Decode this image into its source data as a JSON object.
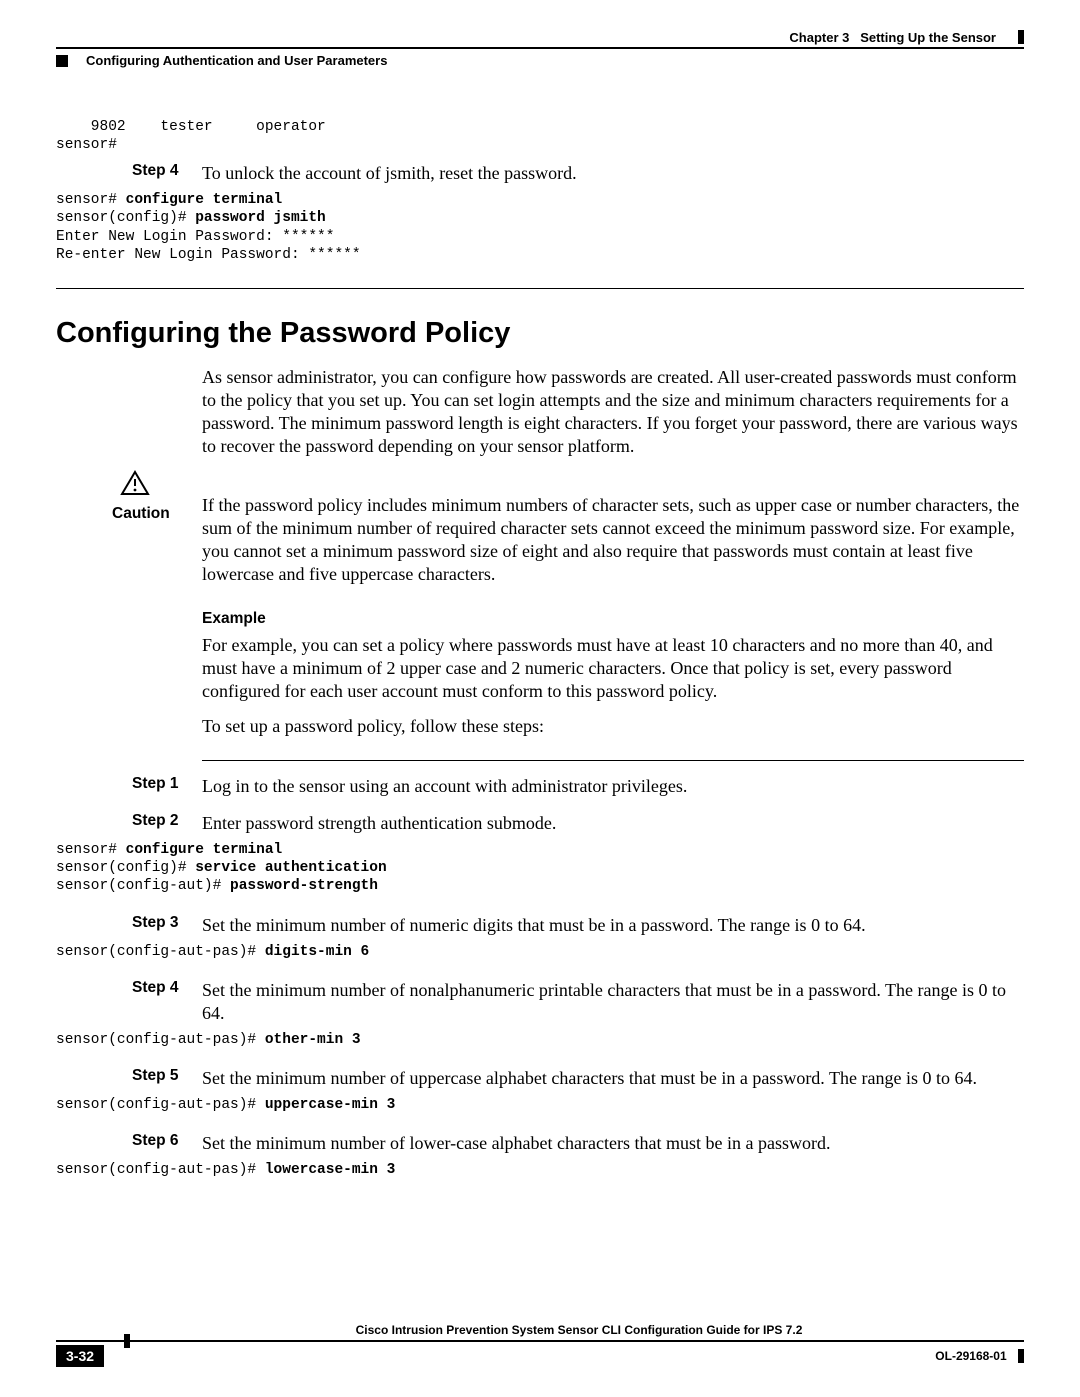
{
  "header": {
    "chapter": "Chapter 3",
    "chapter_title": "Setting Up the Sensor",
    "section": "Configuring Authentication and User Parameters"
  },
  "pretext_code": "    9802    tester     operator\nsensor#",
  "stepA": {
    "label": "Step 4",
    "text": "To unlock the account of jsmith, reset the password.",
    "code_plain1": "sensor# ",
    "code_bold1": "configure terminal",
    "code_plain2": "sensor(config)# ",
    "code_bold2": "password jsmith",
    "code_rest": "Enter New Login Password: ******\nRe-enter New Login Password: ******"
  },
  "section_title": "Configuring the Password Policy",
  "intro_para": "As sensor administrator, you can configure how passwords are created. All user-created passwords must conform to the policy that you set up. You can set login attempts and the size and minimum characters requirements for a password. The minimum password length is eight characters. If you forget your password, there are various ways to recover the password depending on your sensor platform.",
  "caution": {
    "label": "Caution",
    "text": "If the password policy includes minimum numbers of character sets, such as upper case or number characters, the sum of the minimum number of required character sets cannot exceed the minimum password size. For example, you cannot set a minimum password size of eight and also require that passwords must contain at least five lowercase and five uppercase characters."
  },
  "example_hdr": "Example",
  "example_para": "For example, you can set a policy where passwords must have at least 10 characters and no more than 40, and must have a minimum of 2 upper case and 2 numeric characters. Once that policy is set, every password configured for each user account must conform to this password policy.",
  "example_followup": "To set up a password policy, follow these steps:",
  "steps": [
    {
      "label": "Step 1",
      "text": "Log in to the sensor using an account with administrator privileges."
    },
    {
      "label": "Step 2",
      "text": "Enter password strength authentication submode.",
      "code_plain1": "sensor# ",
      "code_bold1": "configure terminal",
      "code_plain2": "sensor(config)# ",
      "code_bold2": "service authentication",
      "code_plain3": "sensor(config-aut)# ",
      "code_bold3": "password-strength"
    },
    {
      "label": "Step 3",
      "text": "Set the minimum number of numeric digits that must be in a password. The range is 0 to 64.",
      "code_plain1": "sensor(config-aut-pas)# ",
      "code_bold1": "digits-min 6"
    },
    {
      "label": "Step 4",
      "text": "Set the minimum number of nonalphanumeric printable characters that must be in a password. The range is 0 to 64.",
      "code_plain1": "sensor(config-aut-pas)# ",
      "code_bold1": "other-min 3"
    },
    {
      "label": "Step 5",
      "text": "Set the minimum number of uppercase alphabet characters that must be in a password. The range is 0 to 64.",
      "code_plain1": "sensor(config-aut-pas)# ",
      "code_bold1": "uppercase-min 3"
    },
    {
      "label": "Step 6",
      "text": "Set the minimum number of lower-case alphabet characters that must be in a password.",
      "code_plain1": "sensor(config-aut-pas)# ",
      "code_bold1": "lowercase-min 3"
    }
  ],
  "footer": {
    "guide": "Cisco Intrusion Prevention System Sensor CLI Configuration Guide for IPS 7.2",
    "page": "3-32",
    "docnum": "OL-29168-01"
  }
}
